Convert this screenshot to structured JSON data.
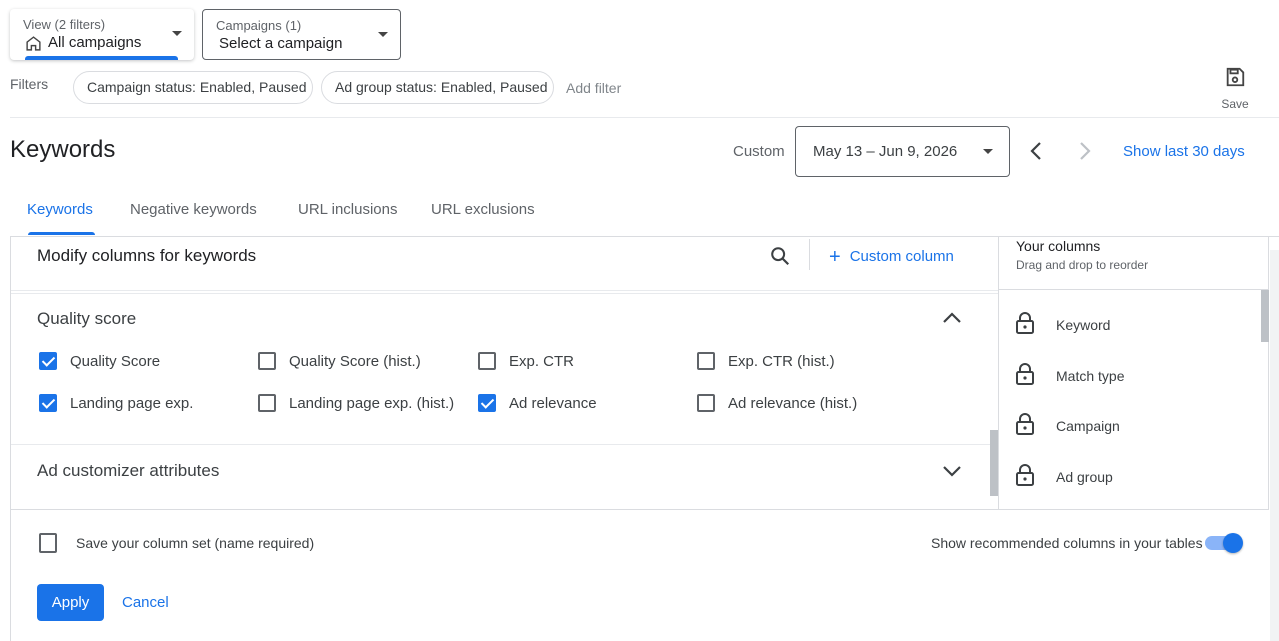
{
  "top": {
    "view_selector": {
      "small": "View (2 filters)",
      "main": "All campaigns"
    },
    "campaign_selector": {
      "small": "Campaigns (1)",
      "main": "Select a campaign"
    }
  },
  "filters": {
    "label": "Filters",
    "chips": [
      "Campaign status: Enabled, Paused",
      "Ad group status: Enabled, Paused"
    ],
    "add_filter": "Add filter",
    "save_label": "Save"
  },
  "header": {
    "title": "Keywords",
    "range_label": "Custom",
    "date_range": "May 13 – Jun 9, 2026",
    "show_last": "Show last 30 days"
  },
  "tabs": [
    "Keywords",
    "Negative keywords",
    "URL inclusions",
    "URL exclusions"
  ],
  "modify": {
    "title": "Modify columns for keywords",
    "custom_column": "Custom column",
    "quality_score": {
      "title": "Quality score",
      "items": [
        {
          "label": "Quality Score",
          "checked": true
        },
        {
          "label": "Quality Score (hist.)",
          "checked": false
        },
        {
          "label": "Exp. CTR",
          "checked": false
        },
        {
          "label": "Exp. CTR (hist.)",
          "checked": false
        },
        {
          "label": "Landing page exp.",
          "checked": true
        },
        {
          "label": "Landing page exp. (hist.)",
          "checked": false
        },
        {
          "label": "Ad relevance",
          "checked": true
        },
        {
          "label": "Ad relevance (hist.)",
          "checked": false
        }
      ]
    },
    "ad_customizer": {
      "title": "Ad customizer attributes"
    }
  },
  "your_columns": {
    "title": "Your columns",
    "subtitle": "Drag and drop to reorder",
    "items": [
      "Keyword",
      "Match type",
      "Campaign",
      "Ad group"
    ]
  },
  "bottom": {
    "save_set": "Save your column set (name required)",
    "show_recommended": "Show recommended columns in your tables",
    "toggle_on": true,
    "apply": "Apply",
    "cancel": "Cancel"
  },
  "colors": {
    "accent": "#1a73e8",
    "text": "#202124",
    "muted": "#5f6368",
    "border": "#dadce0"
  }
}
